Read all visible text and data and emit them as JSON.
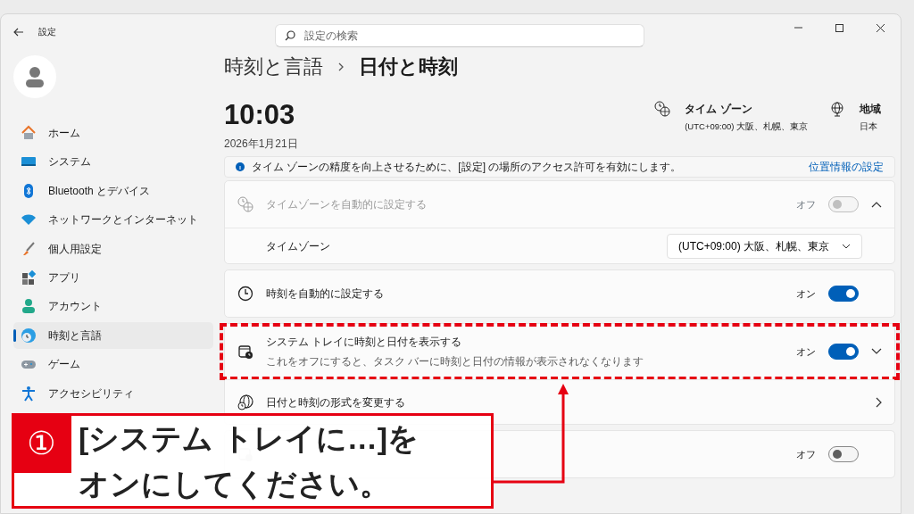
{
  "window": {
    "title": "設定"
  },
  "search": {
    "placeholder": "設定の検索"
  },
  "sidebar": {
    "items": [
      {
        "label": "ホーム",
        "selected": false
      },
      {
        "label": "システム",
        "selected": false
      },
      {
        "label": "Bluetooth とデバイス",
        "selected": false
      },
      {
        "label": "ネットワークとインターネット",
        "selected": false
      },
      {
        "label": "個人用設定",
        "selected": false
      },
      {
        "label": "アプリ",
        "selected": false
      },
      {
        "label": "アカウント",
        "selected": false
      },
      {
        "label": "時刻と言語",
        "selected": true
      },
      {
        "label": "ゲーム",
        "selected": false
      },
      {
        "label": "アクセシビリティ",
        "selected": false
      }
    ]
  },
  "breadcrumb": [
    "時刻と言語",
    "日付と時刻"
  ],
  "clock": {
    "time": "10:03",
    "date": "2026年1月21日"
  },
  "header_info": [
    {
      "title": "タイム ゾーン",
      "value": "(UTC+09:00) 大阪、札幌、東京"
    },
    {
      "title": "地域",
      "value": "日本"
    }
  ],
  "info_bar": {
    "message": "タイム ゾーンの精度を向上させるために、[設定] の場所のアクセス許可を有効にします。",
    "link": "位置情報の設定"
  },
  "groups": [
    {
      "rows": [
        {
          "kind": "toggle",
          "label": "タイムゾーンを自動的に設定する",
          "state_label": "オフ",
          "on": false,
          "disabled": true,
          "expanded": true
        },
        {
          "kind": "dropdown",
          "label": "タイムゾーン",
          "value": "(UTC+09:00) 大阪、札幌、東京"
        }
      ]
    },
    {
      "rows": [
        {
          "kind": "toggle",
          "label": "時刻を自動的に設定する",
          "state_label": "オン",
          "on": true,
          "disabled": false
        }
      ]
    },
    {
      "rows": [
        {
          "kind": "toggle",
          "label": "システム トレイに時刻と日付を表示する",
          "description": "これをオフにすると、タスク バーに時刻と日付の情報が表示されなくなります",
          "state_label": "オン",
          "on": true,
          "disabled": false,
          "expanded": false
        },
        {
          "kind": "link",
          "label": "日付と時刻の形式を変更する"
        }
      ]
    },
    {
      "rows": [
        {
          "kind": "toggle",
          "state_label": "オフ",
          "on": false,
          "disabled": false
        }
      ]
    }
  ],
  "annotation": {
    "number": "①",
    "lines": [
      "[システム トレイに…]を",
      "オンにしてください。"
    ]
  }
}
